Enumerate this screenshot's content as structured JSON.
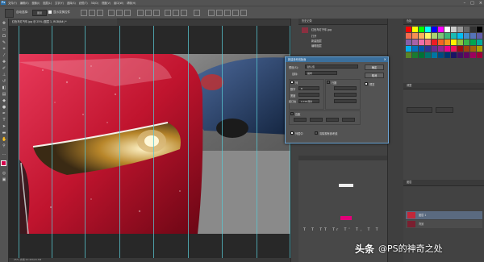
{
  "menubar": {
    "logo": "Ps",
    "items": [
      "文件(F)",
      "编辑(E)",
      "图像(I)",
      "图层(L)",
      "文字(Y)",
      "选择(S)",
      "滤镜(T)",
      "3D(D)",
      "视图(V)",
      "窗口(W)",
      "帮助(H)"
    ]
  },
  "options": {
    "auto_select_label": "自动选择:",
    "auto_select_value": "图层",
    "transform_label": "显示变换控件"
  },
  "document": {
    "tab_title": "红色车灯汽车.jpg @ 25% (图层 1, RGB/8#) *",
    "status": "25% 文档:10.2M/20.3M"
  },
  "history": {
    "title": "历史记录",
    "items": [
      "红色车灯汽车.jpg",
      "打开",
      "新建图层",
      "编辑图层"
    ]
  },
  "dialog": {
    "title": "新建参考线版面",
    "preset_label": "预设(S):",
    "preset_value": "默认值",
    "target_label": "目标:",
    "target_value": "画布",
    "columns_label": "列",
    "rows_label": "行数",
    "number_label": "数字",
    "number_value": "8",
    "width_label": "宽度",
    "gutter_label": "装订线",
    "gutter_value": "0.738 厘米",
    "margin_label": "边距",
    "center_label": "列居中",
    "clear_label": "清除现有参考线",
    "preview_label": "预览",
    "ok_label": "确定",
    "cancel_label": "取消"
  },
  "swatches": {
    "title": "色板",
    "colors": [
      "#ff0000",
      "#ffff00",
      "#00ff00",
      "#00ffff",
      "#0000ff",
      "#ff00ff",
      "#ffffff",
      "#cccccc",
      "#999999",
      "#666666",
      "#333333",
      "#000000",
      "#f26c4f",
      "#f68e55",
      "#fbaf5c",
      "#fff467",
      "#acd372",
      "#7cc576",
      "#3bb878",
      "#1abbb4",
      "#00bff3",
      "#438ccb",
      "#5574b9",
      "#605ca8",
      "#855fa8",
      "#a763a8",
      "#f06ea9",
      "#f26d7d",
      "#ed1c24",
      "#f26522",
      "#f7941d",
      "#fff200",
      "#8dc63f",
      "#39b54a",
      "#00a651",
      "#00a99d",
      "#00aeef",
      "#0072bc",
      "#0054a6",
      "#2e3192",
      "#662d91",
      "#92278f",
      "#ec008c",
      "#ed145b",
      "#9e0b0f",
      "#a0410d",
      "#a36209",
      "#aba000",
      "#598527",
      "#1a7b30",
      "#007236",
      "#00746b",
      "#0076a3",
      "#004b80",
      "#003471",
      "#1b1464",
      "#440e62",
      "#630460",
      "#9e005d",
      "#9e0039"
    ]
  },
  "adjust": {
    "title": "调整",
    "kind": "像素"
  },
  "layers": {
    "title": "图层",
    "items": [
      {
        "name": "图层 1",
        "color": "#c2283a"
      },
      {
        "name": "背景",
        "color": "#7a2030"
      }
    ]
  },
  "watermark": {
    "brand": "头条",
    "handle": "@PS的神奇之处"
  }
}
